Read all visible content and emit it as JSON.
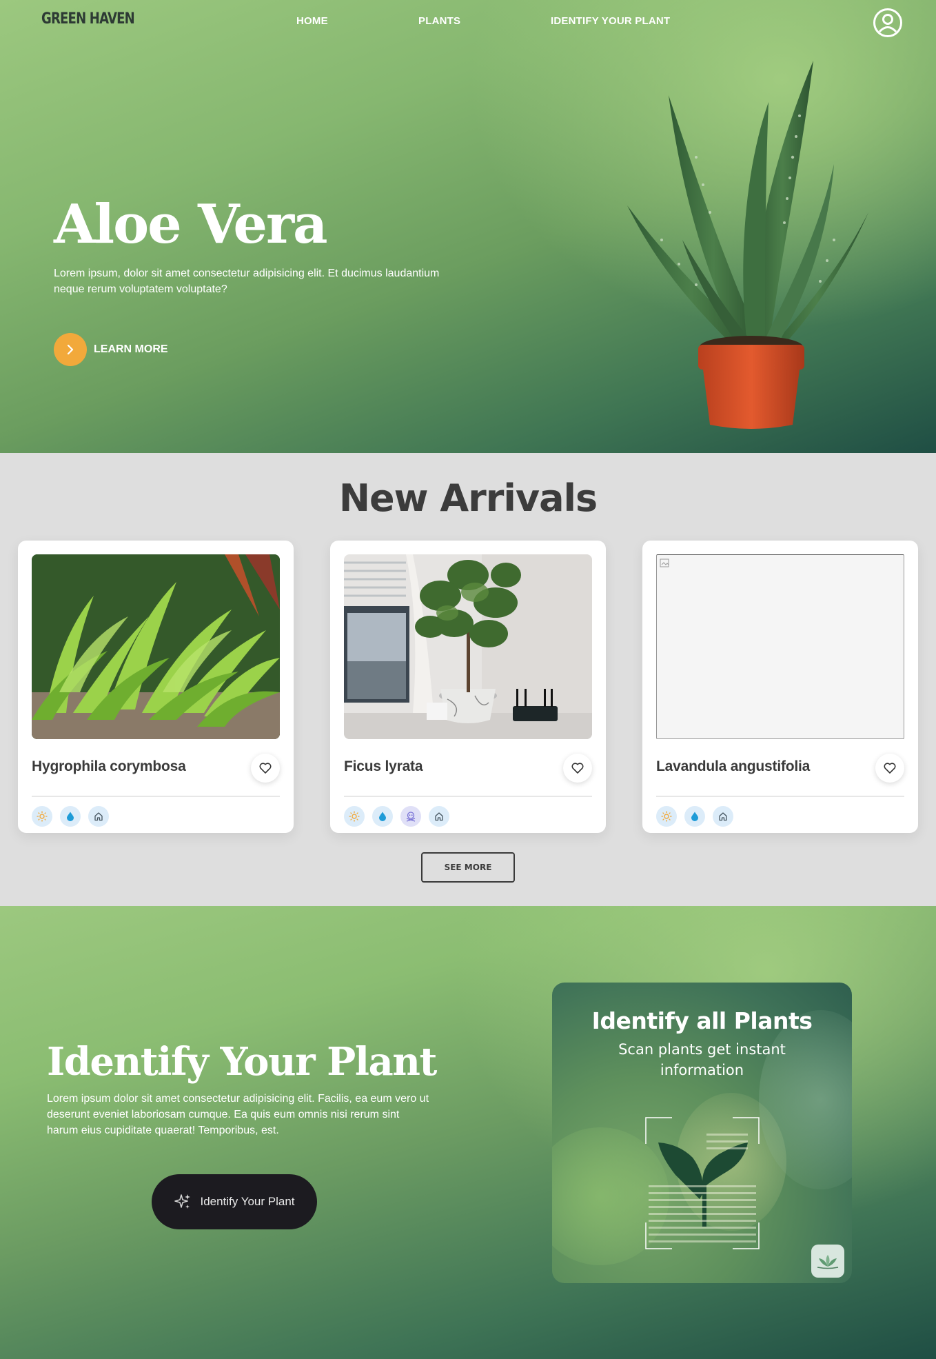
{
  "nav": {
    "logo": "GREEN HAVEN",
    "links": [
      "HOME",
      "PLANTS",
      "IDENTIFY YOUR PLANT"
    ]
  },
  "hero": {
    "title": "Aloe Vera",
    "description": "Lorem ipsum, dolor sit amet consectetur adipisicing elit. Et ducimus laudantium neque rerum voluptatem voluptate?",
    "cta_label": "LEARN MORE",
    "accent": "#f2a93b"
  },
  "arrivals": {
    "title": "New Arrivals",
    "cards": [
      {
        "name": "Hygrophila corymbosa",
        "badges": [
          "sun-icon",
          "water-drop-icon",
          "house-icon"
        ]
      },
      {
        "name": "Ficus lyrata",
        "badges": [
          "sun-icon",
          "water-drop-icon",
          "toxic-skull-icon",
          "house-icon"
        ]
      },
      {
        "name": "Lavandula angustifolia",
        "badges": [
          "sun-icon",
          "water-drop-icon",
          "house-icon"
        ]
      }
    ],
    "see_more_label": "SEE MORE"
  },
  "identify": {
    "title": "Identify Your Plant",
    "description": "Lorem ipsum dolor sit amet consectetur adipisicing elit. Facilis, ea eum vero ut deserunt eveniet laboriosam cumque. Ea quis eum omnis nisi rerum sint harum eius cupiditate quaerat! Temporibus, est.",
    "button_label": "Identify Your Plant",
    "scan_card": {
      "title": "Identify all Plants",
      "subtitle": "Scan plants get instant information"
    }
  }
}
